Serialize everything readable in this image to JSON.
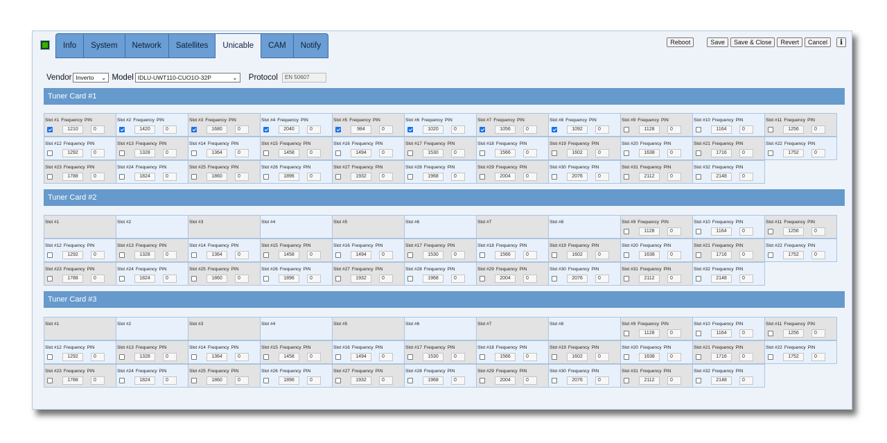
{
  "tabs": [
    "Info",
    "System",
    "Network",
    "Satellites",
    "Unicable",
    "CAM",
    "Notify"
  ],
  "active_tab": "Unicable",
  "buttons": {
    "reboot": "Reboot",
    "save": "Save",
    "save_close": "Save & Close",
    "revert": "Revert",
    "cancel": "Cancel",
    "info": "i"
  },
  "config": {
    "vendor_label": "Vendor",
    "vendor_value": "Inverto",
    "model_label": "Model",
    "model_value": "IDLU-UWT110-CUO1O-32P",
    "protocol_label": "Protocol",
    "protocol_value": "EN 50607"
  },
  "labels": {
    "frequency": "Frequency",
    "pin": "PIN"
  },
  "cards": [
    {
      "title": "Tuner Card #1",
      "slots": [
        {
          "n": "Slot #1",
          "f": "1210",
          "p": "0",
          "on": true
        },
        {
          "n": "Slot #2",
          "f": "1420",
          "p": "0",
          "on": true
        },
        {
          "n": "Slot #3",
          "f": "1680",
          "p": "0",
          "on": true
        },
        {
          "n": "Slot #4",
          "f": "2040",
          "p": "0",
          "on": true
        },
        {
          "n": "Slot #5",
          "f": "984",
          "p": "0",
          "on": true
        },
        {
          "n": "Slot #6",
          "f": "1020",
          "p": "0",
          "on": true
        },
        {
          "n": "Slot #7",
          "f": "1056",
          "p": "0",
          "on": true
        },
        {
          "n": "Slot #8",
          "f": "1092",
          "p": "0",
          "on": true
        },
        {
          "n": "Slot #9",
          "f": "1128",
          "p": "0",
          "on": false
        },
        {
          "n": "Slot #10",
          "f": "1164",
          "p": "0",
          "on": false
        },
        {
          "n": "Slot #11",
          "f": "1256",
          "p": "0",
          "on": false
        },
        {
          "n": "Slot #12",
          "f": "1292",
          "p": "0",
          "on": false
        },
        {
          "n": "Slot #13",
          "f": "1328",
          "p": "0",
          "on": false
        },
        {
          "n": "Slot #14",
          "f": "1364",
          "p": "0",
          "on": false
        },
        {
          "n": "Slot #15",
          "f": "1458",
          "p": "0",
          "on": false
        },
        {
          "n": "Slot #16",
          "f": "1494",
          "p": "0",
          "on": false
        },
        {
          "n": "Slot #17",
          "f": "1530",
          "p": "0",
          "on": false
        },
        {
          "n": "Slot #18",
          "f": "1566",
          "p": "0",
          "on": false
        },
        {
          "n": "Slot #19",
          "f": "1602",
          "p": "0",
          "on": false
        },
        {
          "n": "Slot #20",
          "f": "1638",
          "p": "0",
          "on": false
        },
        {
          "n": "Slot #21",
          "f": "1716",
          "p": "0",
          "on": false
        },
        {
          "n": "Slot #22",
          "f": "1752",
          "p": "0",
          "on": false
        },
        {
          "n": "Slot #23",
          "f": "1788",
          "p": "0",
          "on": false
        },
        {
          "n": "Slot #24",
          "f": "1824",
          "p": "0",
          "on": false
        },
        {
          "n": "Slot #25",
          "f": "1860",
          "p": "0",
          "on": false
        },
        {
          "n": "Slot #26",
          "f": "1896",
          "p": "0",
          "on": false
        },
        {
          "n": "Slot #27",
          "f": "1932",
          "p": "0",
          "on": false
        },
        {
          "n": "Slot #28",
          "f": "1968",
          "p": "0",
          "on": false
        },
        {
          "n": "Slot #29",
          "f": "2004",
          "p": "0",
          "on": false
        },
        {
          "n": "Slot #30",
          "f": "2076",
          "p": "0",
          "on": false
        },
        {
          "n": "Slot #31",
          "f": "2112",
          "p": "0",
          "on": false
        },
        {
          "n": "Slot #32",
          "f": "2148",
          "p": "0",
          "on": false
        }
      ]
    },
    {
      "title": "Tuner Card #2",
      "slots": [
        {
          "n": "Slot #1",
          "empty": true
        },
        {
          "n": "Slot #2",
          "empty": true
        },
        {
          "n": "Slot #3",
          "empty": true
        },
        {
          "n": "Slot #4",
          "empty": true
        },
        {
          "n": "Slot #5",
          "empty": true
        },
        {
          "n": "Slot #6",
          "empty": true
        },
        {
          "n": "Slot #7",
          "empty": true
        },
        {
          "n": "Slot #8",
          "empty": true
        },
        {
          "n": "Slot #9",
          "f": "1128",
          "p": "0",
          "on": false
        },
        {
          "n": "Slot #10",
          "f": "1164",
          "p": "0",
          "on": false
        },
        {
          "n": "Slot #11",
          "f": "1256",
          "p": "0",
          "on": false
        },
        {
          "n": "Slot #12",
          "f": "1292",
          "p": "0",
          "on": false
        },
        {
          "n": "Slot #13",
          "f": "1328",
          "p": "0",
          "on": false
        },
        {
          "n": "Slot #14",
          "f": "1364",
          "p": "0",
          "on": false
        },
        {
          "n": "Slot #15",
          "f": "1458",
          "p": "0",
          "on": false
        },
        {
          "n": "Slot #16",
          "f": "1494",
          "p": "0",
          "on": false
        },
        {
          "n": "Slot #17",
          "f": "1530",
          "p": "0",
          "on": false
        },
        {
          "n": "Slot #18",
          "f": "1566",
          "p": "0",
          "on": false
        },
        {
          "n": "Slot #19",
          "f": "1602",
          "p": "0",
          "on": false
        },
        {
          "n": "Slot #20",
          "f": "1638",
          "p": "0",
          "on": false
        },
        {
          "n": "Slot #21",
          "f": "1716",
          "p": "0",
          "on": false
        },
        {
          "n": "Slot #22",
          "f": "1752",
          "p": "0",
          "on": false
        },
        {
          "n": "Slot #23",
          "f": "1788",
          "p": "0",
          "on": false
        },
        {
          "n": "Slot #24",
          "f": "1824",
          "p": "0",
          "on": false
        },
        {
          "n": "Slot #25",
          "f": "1860",
          "p": "0",
          "on": false
        },
        {
          "n": "Slot #26",
          "f": "1896",
          "p": "0",
          "on": false
        },
        {
          "n": "Slot #27",
          "f": "1932",
          "p": "0",
          "on": false
        },
        {
          "n": "Slot #28",
          "f": "1968",
          "p": "0",
          "on": false
        },
        {
          "n": "Slot #29",
          "f": "2004",
          "p": "0",
          "on": false
        },
        {
          "n": "Slot #30",
          "f": "2076",
          "p": "0",
          "on": false
        },
        {
          "n": "Slot #31",
          "f": "2112",
          "p": "0",
          "on": false
        },
        {
          "n": "Slot #32",
          "f": "2148",
          "p": "0",
          "on": false
        }
      ]
    },
    {
      "title": "Tuner Card #3",
      "slots": [
        {
          "n": "Slot #1",
          "empty": true
        },
        {
          "n": "Slot #2",
          "empty": true
        },
        {
          "n": "Slot #3",
          "empty": true
        },
        {
          "n": "Slot #4",
          "empty": true
        },
        {
          "n": "Slot #5",
          "empty": true
        },
        {
          "n": "Slot #6",
          "empty": true
        },
        {
          "n": "Slot #7",
          "empty": true
        },
        {
          "n": "Slot #8",
          "empty": true
        },
        {
          "n": "Slot #9",
          "f": "1128",
          "p": "0",
          "on": false
        },
        {
          "n": "Slot #10",
          "f": "1164",
          "p": "0",
          "on": false
        },
        {
          "n": "Slot #11",
          "f": "1256",
          "p": "0",
          "on": false
        },
        {
          "n": "Slot #12",
          "f": "1292",
          "p": "0",
          "on": false
        },
        {
          "n": "Slot #13",
          "f": "1328",
          "p": "0",
          "on": false
        },
        {
          "n": "Slot #14",
          "f": "1364",
          "p": "0",
          "on": false
        },
        {
          "n": "Slot #15",
          "f": "1458",
          "p": "0",
          "on": false
        },
        {
          "n": "Slot #16",
          "f": "1494",
          "p": "0",
          "on": false
        },
        {
          "n": "Slot #17",
          "f": "1530",
          "p": "0",
          "on": false
        },
        {
          "n": "Slot #18",
          "f": "1566",
          "p": "0",
          "on": false
        },
        {
          "n": "Slot #19",
          "f": "1602",
          "p": "0",
          "on": false
        },
        {
          "n": "Slot #20",
          "f": "1638",
          "p": "0",
          "on": false
        },
        {
          "n": "Slot #21",
          "f": "1716",
          "p": "0",
          "on": false
        },
        {
          "n": "Slot #22",
          "f": "1752",
          "p": "0",
          "on": false
        },
        {
          "n": "Slot #23",
          "f": "1788",
          "p": "0",
          "on": false
        },
        {
          "n": "Slot #24",
          "f": "1824",
          "p": "0",
          "on": false
        },
        {
          "n": "Slot #25",
          "f": "1860",
          "p": "0",
          "on": false
        },
        {
          "n": "Slot #26",
          "f": "1896",
          "p": "0",
          "on": false
        },
        {
          "n": "Slot #27",
          "f": "1932",
          "p": "0",
          "on": false
        },
        {
          "n": "Slot #28",
          "f": "1968",
          "p": "0",
          "on": false
        },
        {
          "n": "Slot #29",
          "f": "2004",
          "p": "0",
          "on": false
        },
        {
          "n": "Slot #30",
          "f": "2076",
          "p": "0",
          "on": false
        },
        {
          "n": "Slot #31",
          "f": "2112",
          "p": "0",
          "on": false
        },
        {
          "n": "Slot #32",
          "f": "2148",
          "p": "0",
          "on": false
        }
      ]
    }
  ]
}
